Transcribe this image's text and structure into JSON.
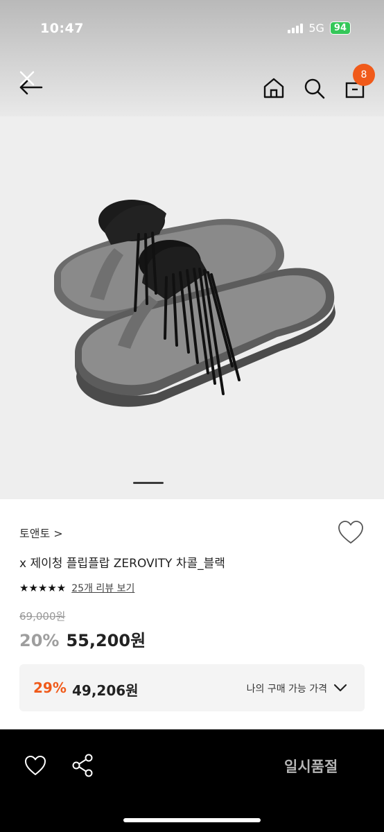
{
  "status_bar": {
    "time": "10:47",
    "network": "5G",
    "battery": "94"
  },
  "nav": {
    "back_icon": "close-back-arrow-icon",
    "home_icon": "home-icon",
    "search_icon": "search-icon",
    "cart_icon": "bag-icon",
    "cart_count": "8"
  },
  "gallery": {
    "current_slide": 1
  },
  "product": {
    "brand": "토앤토 >",
    "title": "x 제이청 플립플랍 ZEROVITY 차콜_블랙",
    "stars": "★★★★★",
    "rating": 5,
    "review_link": "25개 리뷰 보기",
    "original_price": "69,000원",
    "discount": "20%",
    "sale_price": "55,200원"
  },
  "my_price": {
    "discount": "29%",
    "price": "49,206원",
    "label": "나의 구매 가능 가격"
  },
  "bottom_bar": {
    "wish_icon": "heart-icon",
    "share_icon": "share-icon",
    "status": "일시품절"
  },
  "colors": {
    "accent": "#f05a1a",
    "soldout_text": "#b5b5b5",
    "bottom_bar_bg": "#000000",
    "gallery_bg": "#eeeeee"
  }
}
